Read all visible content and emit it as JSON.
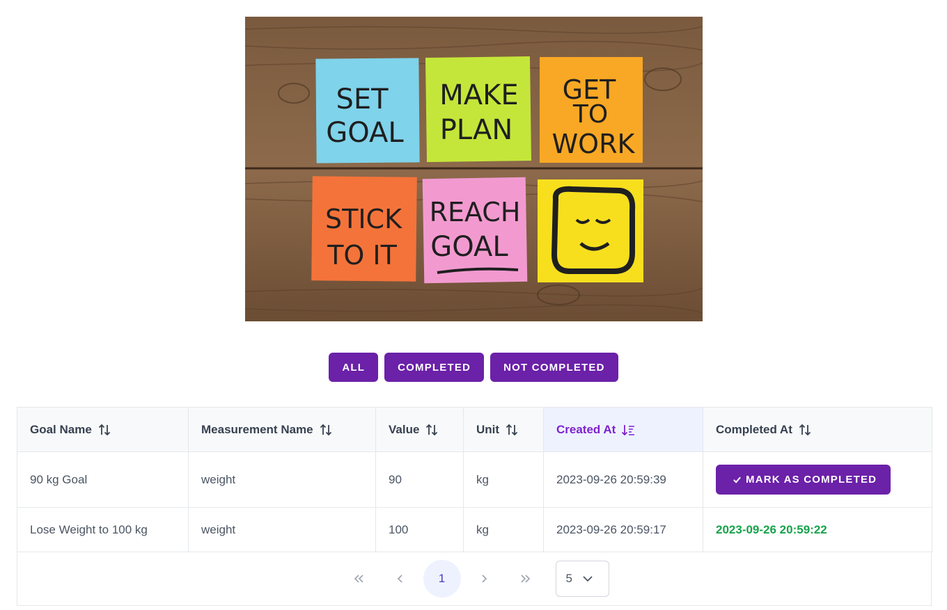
{
  "hero": {
    "notes": [
      {
        "text_lines": [
          "SET",
          "GOAL"
        ],
        "color": "#7fd3ea"
      },
      {
        "text_lines": [
          "MAKE",
          "PLAN"
        ],
        "color": "#c4e63a"
      },
      {
        "text_lines": [
          "GET",
          "TO",
          "WORK"
        ],
        "color": "#f9a825"
      },
      {
        "text_lines": [
          "STICK",
          "TO IT"
        ],
        "color": "#f4733a"
      },
      {
        "text_lines": [
          "REACH",
          "GOAL"
        ],
        "color": "#f29ad0"
      },
      {
        "text_lines": [],
        "color": "#f7df1e",
        "icon": "smiley-face"
      }
    ]
  },
  "filters": {
    "all": "ALL",
    "completed": "COMPLETED",
    "not_completed": "NOT COMPLETED"
  },
  "table": {
    "headers": {
      "goal_name": "Goal Name",
      "measurement_name": "Measurement Name",
      "value": "Value",
      "unit": "Unit",
      "created_at": "Created At",
      "completed_at": "Completed At"
    },
    "sorted_column": "created_at",
    "rows": [
      {
        "goal_name": "90 kg Goal",
        "measurement_name": "weight",
        "value": "90",
        "unit": "kg",
        "created_at": "2023-09-26 20:59:39",
        "completed_at": null,
        "action_label": "MARK AS COMPLETED"
      },
      {
        "goal_name": "Lose Weight to 100 kg",
        "measurement_name": "weight",
        "value": "100",
        "unit": "kg",
        "created_at": "2023-09-26 20:59:17",
        "completed_at": "2023-09-26 20:59:22"
      }
    ]
  },
  "paginator": {
    "first": "«",
    "prev": "‹",
    "current_page": "1",
    "next": "›",
    "last": "»",
    "rows_per_page": "5"
  },
  "colors": {
    "accent": "#6b21a8",
    "active_header_text": "#7e22ce",
    "active_header_bg": "#eef2ff",
    "completed_text": "#16a34a"
  }
}
